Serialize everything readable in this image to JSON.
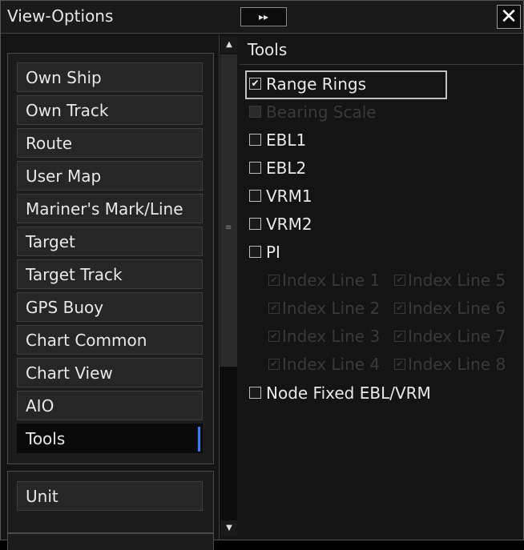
{
  "window": {
    "title": "View-Options",
    "collapse_label": "▸▸",
    "close_label": "✕"
  },
  "nav": {
    "items": [
      {
        "label": "Own Ship"
      },
      {
        "label": "Own Track"
      },
      {
        "label": "Route"
      },
      {
        "label": "User Map"
      },
      {
        "label": "Mariner's Mark/Line"
      },
      {
        "label": "Target"
      },
      {
        "label": "Target Track"
      },
      {
        "label": "GPS Buoy"
      },
      {
        "label": "Chart Common"
      },
      {
        "label": "Chart View"
      },
      {
        "label": "AIO"
      },
      {
        "label": "Tools",
        "selected": true
      }
    ],
    "unit_label": "Unit"
  },
  "scrollbar": {
    "up_icon": "▲",
    "down_icon": "▼",
    "grip_icon": "≡"
  },
  "content": {
    "title": "Tools",
    "options": [
      {
        "label": "Range Rings",
        "checked": true,
        "enabled": true
      },
      {
        "label": "Bearing Scale",
        "checked": false,
        "enabled": false
      },
      {
        "label": "EBL1",
        "checked": false,
        "enabled": true
      },
      {
        "label": "EBL2",
        "checked": false,
        "enabled": true
      },
      {
        "label": "VRM1",
        "checked": false,
        "enabled": true
      },
      {
        "label": "VRM2",
        "checked": false,
        "enabled": true
      },
      {
        "label": "PI",
        "checked": false,
        "enabled": true
      }
    ],
    "index_lines": [
      {
        "label": "Index Line 1",
        "checked": true,
        "enabled": false
      },
      {
        "label": "Index Line 5",
        "checked": true,
        "enabled": false
      },
      {
        "label": "Index Line 2",
        "checked": true,
        "enabled": false
      },
      {
        "label": "Index Line 6",
        "checked": true,
        "enabled": false
      },
      {
        "label": "Index Line 3",
        "checked": true,
        "enabled": false
      },
      {
        "label": "Index Line 7",
        "checked": true,
        "enabled": false
      },
      {
        "label": "Index Line 4",
        "checked": true,
        "enabled": false
      },
      {
        "label": "Index Line 8",
        "checked": true,
        "enabled": false
      }
    ],
    "node_fixed": {
      "label": "Node Fixed EBL/VRM",
      "checked": false,
      "enabled": true
    },
    "check_mark": "✔"
  }
}
